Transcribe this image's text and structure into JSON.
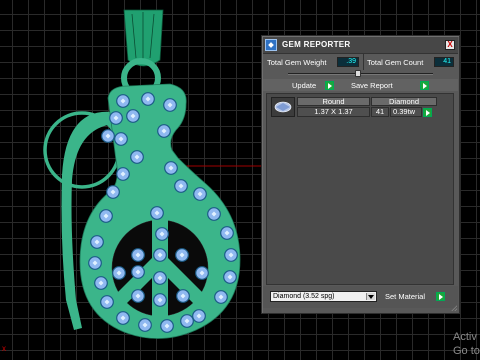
{
  "panel": {
    "title": "GEM REPORTER",
    "close_label": "X",
    "total_weight_label": "Total Gem Weight",
    "total_weight_value": ".39",
    "total_count_label": "Total Gem Count",
    "total_count_value": "41",
    "slider_value_fraction": 0.48,
    "update_label": "Update",
    "save_report_label": "Save Report",
    "columns": [
      "Round",
      "Diamond"
    ],
    "rows": [
      {
        "size": "1.37 X 1.37",
        "count": "41",
        "weight": "0.39tw"
      }
    ],
    "material_selected": "Diamond   (3.52 spg)",
    "set_material_label": "Set Material"
  },
  "viewport": {
    "axis_mark": "x",
    "pendant_color": "#3bb58a",
    "stone_color": "#8fb8f0"
  },
  "watermark": {
    "line1": "Activ",
    "line2": "Go to"
  },
  "colors": {
    "accent_green": "#1aa83a",
    "value_text": "#22ffff"
  }
}
